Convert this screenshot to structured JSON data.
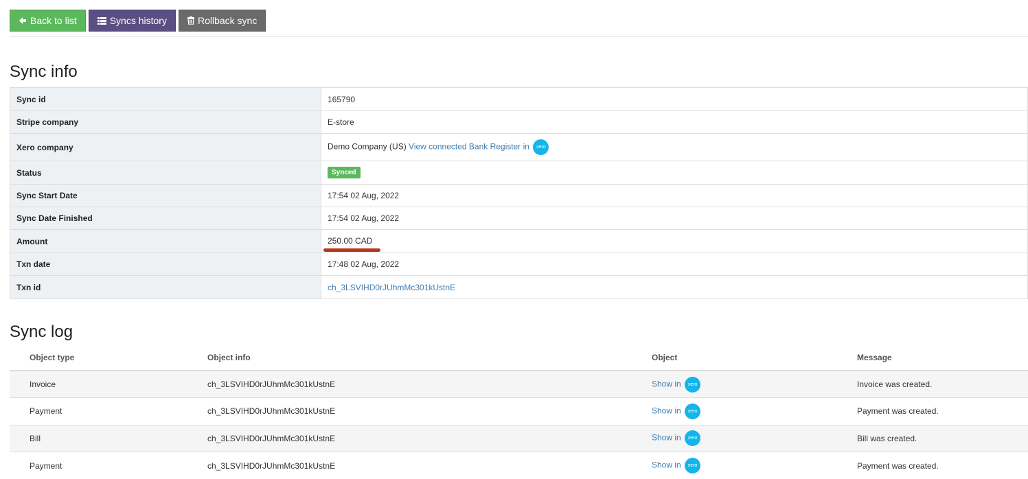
{
  "toolbar": {
    "back_label": "Back to list",
    "history_label": "Syncs history",
    "rollback_label": "Rollback sync"
  },
  "sync_info": {
    "title": "Sync info",
    "rows": {
      "sync_id": {
        "label": "Sync id",
        "value": "165790"
      },
      "stripe_company": {
        "label": "Stripe company",
        "value": "E-store"
      },
      "xero_company": {
        "label": "Xero company",
        "value": "Demo Company (US)",
        "link": "View connected Bank Register in"
      },
      "status": {
        "label": "Status",
        "value": "Synced"
      },
      "start_date": {
        "label": "Sync Start Date",
        "value": "17:54 02 Aug, 2022"
      },
      "finished_date": {
        "label": "Sync Date Finished",
        "value": "17:54 02 Aug, 2022"
      },
      "amount": {
        "label": "Amount",
        "value": "250.00 CAD"
      },
      "txn_date": {
        "label": "Txn date",
        "value": "17:48 02 Aug, 2022"
      },
      "txn_id": {
        "label": "Txn id",
        "value": "ch_3LSVIHD0rJUhmMc301kUstnE"
      }
    }
  },
  "xero_logo_text": "xero",
  "sync_log": {
    "title": "Sync log",
    "headers": [
      "Object type",
      "Object info",
      "Object",
      "Message"
    ],
    "show_label": "Show in",
    "rows": [
      {
        "type": "Invoice",
        "info": "ch_3LSVIHD0rJUhmMc301kUstnE",
        "message": "Invoice was created."
      },
      {
        "type": "Payment",
        "info": "ch_3LSVIHD0rJUhmMc301kUstnE",
        "message": "Payment was created."
      },
      {
        "type": "Bill",
        "info": "ch_3LSVIHD0rJUhmMc301kUstnE",
        "message": "Bill was created."
      },
      {
        "type": "Payment",
        "info": "ch_3LSVIHD0rJUhmMc301kUstnE",
        "message": "Payment was created."
      }
    ]
  },
  "colors": {
    "green": "#5cb85c",
    "purple": "#5a4f82",
    "gray": "#6a6a6a",
    "xero": "#13b5ea",
    "link": "#3f7fb5",
    "annotation": "#b33a1a"
  },
  "icons": [
    "arrow-left-icon",
    "table-icon",
    "trash-icon",
    "xero-logo"
  ]
}
